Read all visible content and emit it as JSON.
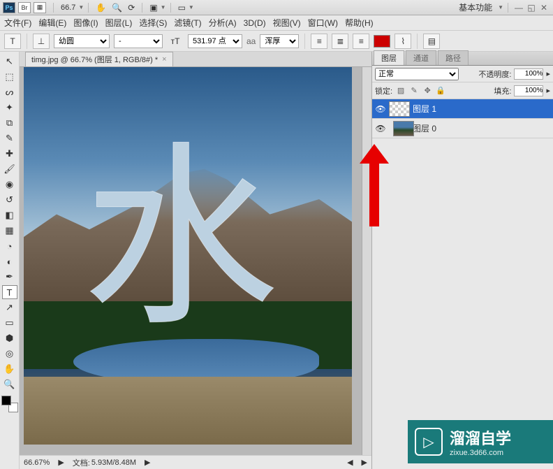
{
  "titlebar": {
    "zoom": "66.7",
    "workspace_label": "基本功能"
  },
  "menu": {
    "file": "文件(F)",
    "edit": "编辑(E)",
    "image": "图像(I)",
    "layer": "图层(L)",
    "select": "选择(S)",
    "filter": "滤镜(T)",
    "analysis": "分析(A)",
    "threed": "3D(D)",
    "view": "视图(V)",
    "window": "窗口(W)",
    "help": "帮助(H)"
  },
  "options": {
    "font_family": "幼圆",
    "font_style": "-",
    "font_size": "531.97 点",
    "aa_label": "aa",
    "aa_value": "浑厚",
    "text_color": "#cc0000"
  },
  "doc": {
    "tab_title": "timg.jpg @ 66.7% (图层 1, RGB/8#) *"
  },
  "canvas_char": "水",
  "status": {
    "zoom": "66.67%",
    "doc_label": "文档:",
    "doc_size": "5.93M/8.48M"
  },
  "panels": {
    "tab_layers": "图层",
    "tab_channels": "通道",
    "tab_paths": "路径",
    "blend_mode": "正常",
    "opacity_label": "不透明度:",
    "opacity_value": "100%",
    "lock_label": "锁定:",
    "fill_label": "填充:",
    "fill_value": "100%",
    "layer1": "图层 1",
    "layer0": "图层 0"
  },
  "watermark": {
    "title": "溜溜自学",
    "url": "zixue.3d66.com"
  }
}
